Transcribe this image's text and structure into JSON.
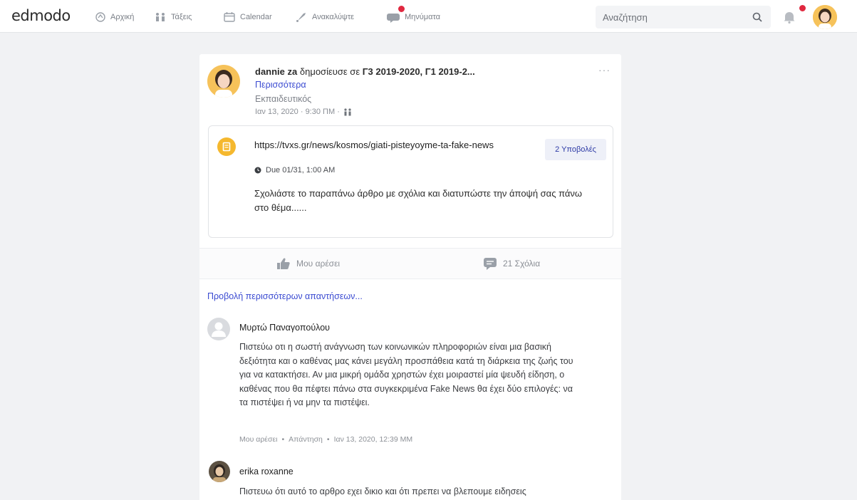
{
  "topbar": {
    "logo": "edmodo",
    "nav": [
      {
        "label": "Αρχική"
      },
      {
        "label": "Τάξεις"
      },
      {
        "label": "Calendar"
      },
      {
        "label": "Ανακαλύψτε"
      },
      {
        "label": "Μηνύματα"
      }
    ],
    "search_placeholder": "Αναζήτηση"
  },
  "post": {
    "author": "dannie za",
    "action_text": " δημοσίευσε σε ",
    "groups": "Γ3 2019-2020,  Γ1 2019-2...",
    "more_label": "Περισσότερα",
    "role": "Εκπαιδευτικός",
    "timestamp": "Ιαν 13, 2020 · 9:30 ΠΜ ·",
    "assignment": {
      "title": "https://tvxs.gr/news/kosmos/giati-pisteyoyme-ta-fake-news",
      "submissions_label": "2 Υποβολές",
      "due": "Due 01/31, 1:00 AM",
      "body": "Σχολιάστε το παραπάνω άρθρο με σχόλια και διατυπώστε την άποψή σας πάνω στο θέμα......"
    },
    "like_label": "Μου αρέσει",
    "comments_label": "21 Σχόλια",
    "view_more_label": "Προβολή περισσότερων απαντήσεων..."
  },
  "comments": [
    {
      "name": "Μυρτώ Παναγοπούλου",
      "body": "Πιστεύω οτι η σωστή ανάγνωση των κοινωνικών πληροφοριών είναι μια βασική δεξιότητα και ο καθένας μας κάνει μεγάλη προσπάθεια κατά τη διάρκεια της ζωής του για να κατακτήσει. Αν μια μικρή ομάδα χρηστών έχει μοιραστεί μία ψευδή είδηση, ο καθένας που θα πέφτει πάνω στα συγκεκριμένα Fake News θα έχει δύο επιλογές: να τα πιστέψει ή να μην τα πιστέψει.",
      "like": "Μου αρέσει",
      "reply": "Απάντηση",
      "time": "Ιαν 13, 2020, 12:39 ΜΜ"
    },
    {
      "name": "erika roxanne",
      "body": "Πιστευω ότι αυτό το αρθρο εχει δικιο και ότι πρεπει να βλεπουμε ειδησεις"
    }
  ],
  "colors": {
    "link": "#3a4ad1",
    "badge": "#e0283f",
    "assignment_icon": "#f5b82e",
    "avatar_yellow": "#f6c25a"
  }
}
